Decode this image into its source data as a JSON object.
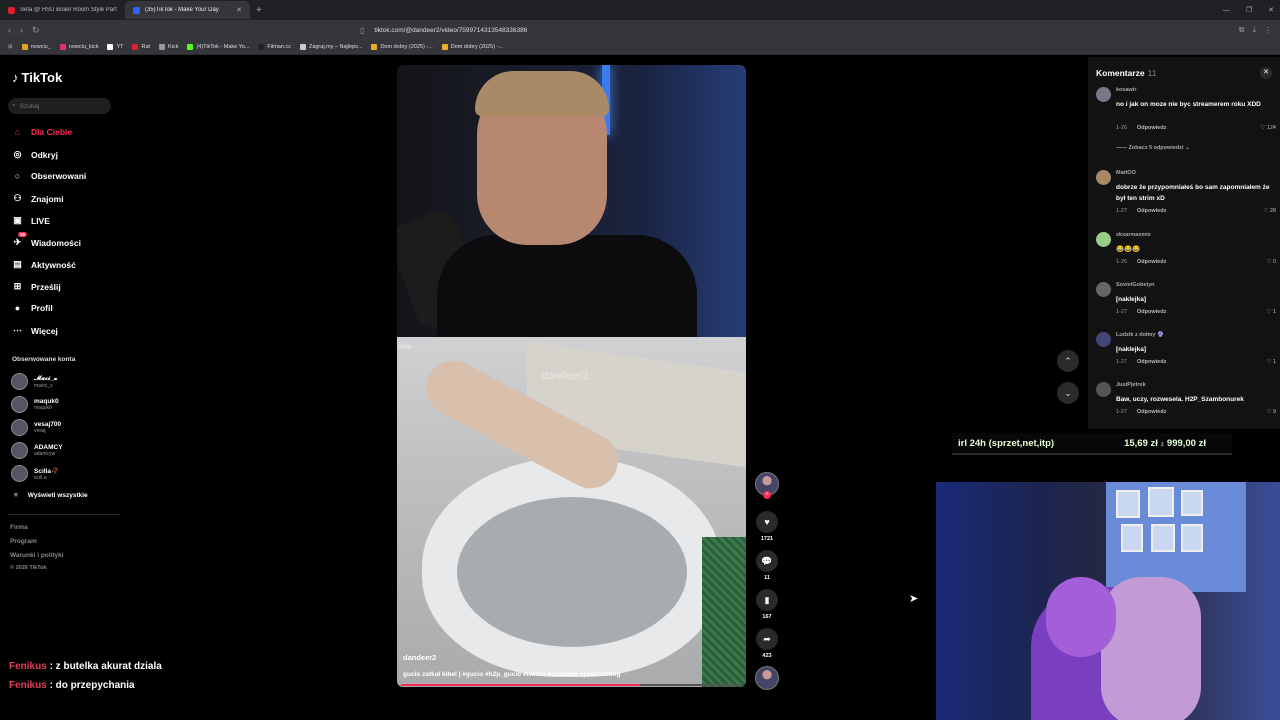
{
  "browser": {
    "tabs": [
      {
        "title": "Sefa @ HSU Boiler Room Style Party",
        "color": "#e02030",
        "active": false
      },
      {
        "title": "(35)TikTok - Make Your Day",
        "color": "#3060ff",
        "active": true
      }
    ],
    "url": "tiktok.com/@dandeer2/video/7599714313548336386",
    "bookmarks": [
      "nowciu_",
      "nowciu_kick",
      "YT",
      "Rat",
      "Kick",
      "(4)TikTok - Make Yo...",
      "Filman.cc",
      "Zagraj.my – Najleps...",
      "Dom dobry (2025) -...",
      "Dom dobry (2025) -..."
    ]
  },
  "sidebar": {
    "logo": "TikTok",
    "search_placeholder": "Szukaj",
    "items": [
      {
        "label": "Dla Ciebie",
        "icon": "home-icon",
        "active": true
      },
      {
        "label": "Odkryj",
        "icon": "compass-icon"
      },
      {
        "label": "Obserwowani",
        "icon": "following-icon"
      },
      {
        "label": "Znajomi",
        "icon": "friends-icon"
      },
      {
        "label": "LIVE",
        "icon": "live-icon"
      },
      {
        "label": "Wiadomości",
        "icon": "messages-icon",
        "badge": "35"
      },
      {
        "label": "Aktywność",
        "icon": "activity-icon"
      },
      {
        "label": "Prześlij",
        "icon": "upload-icon"
      },
      {
        "label": "Profil",
        "icon": "profile-icon"
      },
      {
        "label": "Więcej",
        "icon": "more-icon"
      }
    ],
    "followed_title": "Obserwowane konta",
    "followed": [
      {
        "name": "𝓜𝓪𝓬𝓲_𝔁",
        "handle": "maeci_x"
      },
      {
        "name": "maquk0",
        "handle": "maquk0"
      },
      {
        "name": "vesaj700",
        "handle": "vesaj"
      },
      {
        "name": "ADAMCY",
        "handle": "adamcyai"
      },
      {
        "name": "Scilla🥀",
        "handle": "scill.a"
      }
    ],
    "show_all": "Wyświetl wszystkie",
    "footer": [
      "Firma",
      "Program",
      "Warunki i polityki",
      "© 2026 TikTok"
    ]
  },
  "stream_chat": [
    {
      "user": "Fenikus",
      "text": ": z butelka akurat dziala"
    },
    {
      "user": "Fenikus",
      "text": ": do przepychania"
    }
  ],
  "video": {
    "author": "dandeer2",
    "description": "gucio zatkał kibel | #gucio #h2p_gucio #twitch #streamer #justchatting",
    "watermark": "dandeer2",
    "corner_text": "ottle",
    "progress": 0.7,
    "likes": "1721",
    "comments": "11",
    "saves": "167",
    "shares": "423"
  },
  "comments": {
    "title": "Komentarze",
    "count": "11",
    "reply_label": "Odpowiedz",
    "items": [
      {
        "user": "kosawir",
        "text": "no i jak on moze nie byc streamerem roku XDD",
        "date": "1-26",
        "likes": "124",
        "replies": "Zobacz 5 odpowiedzi"
      },
      {
        "user": "MattOO",
        "text": "dobrze że przypomniałeś bo sam zapomniałem że był ten strim xD",
        "date": "1-27",
        "likes": "28"
      },
      {
        "user": "xkxarmaxmix",
        "text": "😂😂😂",
        "date": "1-26",
        "likes": "0"
      },
      {
        "user": "SovietGobelyn",
        "text": "[naklejka]",
        "date": "1-27",
        "likes": "1"
      },
      {
        "user": "Ludzik z dołmy 🔮",
        "text": "[naklejka]",
        "date": "1-27",
        "likes": "1"
      },
      {
        "user": "JustPjetrek",
        "text": "Baw, uczy, rozwesela. H2P_Szambonurek",
        "date": "1-27",
        "likes": "9"
      }
    ]
  },
  "donation_goal": {
    "label": "irl 24h (sprzet,net,itp)",
    "current": "15,69 zł",
    "separator": "z",
    "target": "999,00 zł"
  }
}
